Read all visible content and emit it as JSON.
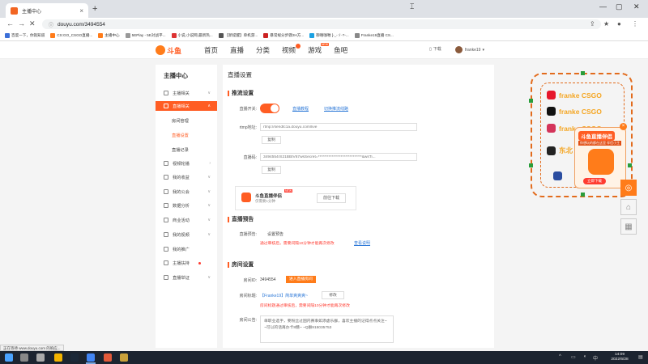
{
  "browser": {
    "tab_title": "主播中心",
    "url": "douyu.com/3494554",
    "bookmarks": [
      "百度一下，你就知道",
      "CS:GO_CSGO直播...",
      "主播中心",
      "5EPlay - 5E对战平...",
      "小说,小说网,最新热...",
      "【新提醒】单机游...",
      "暴常规分步骤2H方...",
      "御嘻咖喱 [-_-ゞ-?-...",
      "Franke19直播 CS..."
    ]
  },
  "site": {
    "logo_text": "斗鱼",
    "nav": [
      "首页",
      "直播",
      "分类",
      "视频",
      "游戏",
      "鱼吧"
    ],
    "game_badge": "NEW",
    "download": "下载",
    "username": "franke19"
  },
  "sidebar": {
    "title": "主播中心",
    "items": [
      {
        "label": "主播相关",
        "arrow": "∨"
      },
      {
        "label": "直播相关",
        "arrow": "∧"
      },
      {
        "label": "房间管理"
      },
      {
        "label": "直播设置"
      },
      {
        "label": "直播记录"
      },
      {
        "label": "视频轮播",
        "arrow": "›"
      },
      {
        "label": "我的收益",
        "arrow": "∨"
      },
      {
        "label": "我的公会",
        "arrow": "∨"
      },
      {
        "label": "数据分析",
        "arrow": "∨"
      },
      {
        "label": "商业活动",
        "arrow": "∨"
      },
      {
        "label": "我的视频",
        "arrow": "∨"
      },
      {
        "label": "我的推广"
      },
      {
        "label": "主播扶持"
      },
      {
        "label": "直播举证",
        "arrow": "∨"
      }
    ]
  },
  "main": {
    "title": "直播设置",
    "stream": {
      "section": "推流设置",
      "switch_label": "直播开关:",
      "tutorial_link": "直播教程",
      "switch_line_link": "切换推流线路",
      "rtmp_label": "rtmp地址:",
      "rtmp_value": "rtmp://sendtc1a.douyu.com/live",
      "copy1": "复制",
      "code_label": "直播码:",
      "code_value": "3494554rS21BBIV67wsSecret=*****************************&wsTi...",
      "copy2": "复制"
    },
    "promo": {
      "name": "斗鱼直播伴侣",
      "sub": "仅需要1分钟",
      "new_badge": "NEW",
      "download": "前往下载"
    },
    "preview": {
      "section": "直播预告",
      "label": "直播预告:",
      "value": "设置预告",
      "warning": "通过审核后，需要间隔10分钟才能再次修改",
      "link": "查看说明"
    },
    "room": {
      "section": "房间设置",
      "id_label": "房间ID:",
      "id_value": "3494554",
      "enter_btn": "进入直播房间",
      "title_label": "房间标题:",
      "title_value": "【Franke19】简单爽爽爽~",
      "modify": "修改",
      "title_warning": "房间标题通过审核后，需要间隔10分钟才能再次修改",
      "notice_label": "房间公告:",
      "notice_line1": "单职业选手，要粉丝过国内赛事如添虚乐群，喜欢主播的记得点点关注~",
      "notice_line2": "~可以的话再办卡8糖~ ~Q群915035753"
    }
  },
  "overlay": {
    "lines": [
      "franke CSGO",
      "franke CSGO",
      "franke CSGO",
      "东北"
    ],
    "card_title": "斗鱼直播伴侣",
    "card_sub": "你想玩的都在这里 伴侣小主",
    "card_btn": "立即下载",
    "close": "×",
    "accent": "#e26b1c"
  },
  "status": {
    "text": "正在等待 www.douyu.com 的响应..."
  },
  "taskbar": {
    "time": "14:09",
    "date": "2022/6/28"
  }
}
